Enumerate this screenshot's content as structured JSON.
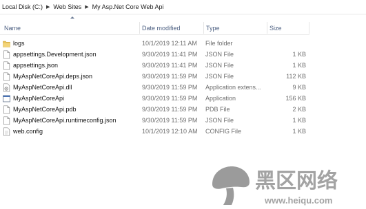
{
  "breadcrumb": {
    "items": [
      "Local Disk (C:)",
      "Web Sites",
      "My Asp.Net Core Web Api"
    ],
    "separator": "▶"
  },
  "columns": {
    "name": "Name",
    "date_modified": "Date modified",
    "type": "Type",
    "size": "Size"
  },
  "sorted_column": "name",
  "files": [
    {
      "name": "logs",
      "date": "10/1/2019 12:11 AM",
      "type": "File folder",
      "size": "",
      "icon": "folder-icon"
    },
    {
      "name": "appsettings.Development.json",
      "date": "9/30/2019 11:41 PM",
      "type": "JSON File",
      "size": "1 KB",
      "icon": "file-icon"
    },
    {
      "name": "appsettings.json",
      "date": "9/30/2019 11:41 PM",
      "type": "JSON File",
      "size": "1 KB",
      "icon": "file-icon"
    },
    {
      "name": "MyAspNetCoreApi.deps.json",
      "date": "9/30/2019 11:59 PM",
      "type": "JSON File",
      "size": "112 KB",
      "icon": "file-icon"
    },
    {
      "name": "MyAspNetCoreApi.dll",
      "date": "9/30/2019 11:59 PM",
      "type": "Application extens...",
      "size": "9 KB",
      "icon": "dll-icon"
    },
    {
      "name": "MyAspNetCoreApi",
      "date": "9/30/2019 11:59 PM",
      "type": "Application",
      "size": "156 KB",
      "icon": "application-icon"
    },
    {
      "name": "MyAspNetCoreApi.pdb",
      "date": "9/30/2019 11:59 PM",
      "type": "PDB File",
      "size": "2 KB",
      "icon": "file-icon"
    },
    {
      "name": "MyAspNetCoreApi.runtimeconfig.json",
      "date": "9/30/2019 11:59 PM",
      "type": "JSON File",
      "size": "1 KB",
      "icon": "file-icon"
    },
    {
      "name": "web.config",
      "date": "10/1/2019 12:10 AM",
      "type": "CONFIG File",
      "size": "1 KB",
      "icon": "config-file-icon"
    }
  ],
  "watermark": {
    "text": "黑区网络",
    "url": "www.heiqu.com",
    "colors": {
      "logo": "#8a8a8a",
      "text": "#9a9a9a"
    }
  },
  "colors": {
    "folder": "#e8c259",
    "header_text": "#4d6082",
    "secondary_text": "#6d6d6d"
  }
}
